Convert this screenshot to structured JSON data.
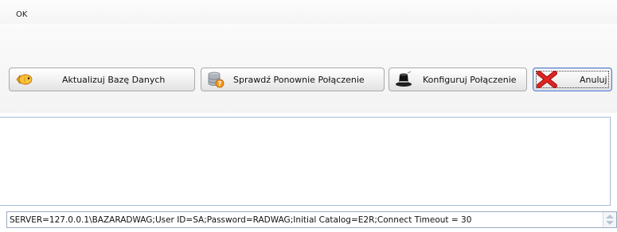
{
  "status": {
    "text": "OK"
  },
  "toolbar": {
    "update_db_label": "Aktualizuj Bazę Danych",
    "check_connection_label": "Sprawdź Ponownie Połączenie",
    "configure_connection_label": "Konfiguruj Połączenie",
    "cancel_label": "Anuluj"
  },
  "log": {
    "text": ""
  },
  "connection": {
    "value": "SERVER=127.0.0.1\\BAZARADWAG;User ID=SA;Password=RADWAG;Initial Catalog=E2R;Connect Timeout = 30"
  },
  "icons": {
    "update_db": "fish-icon",
    "check_connection": "database-check-icon",
    "configure_connection": "magic-hat-icon",
    "cancel": "red-x-icon"
  },
  "colors": {
    "accent_focus_border": "#5a7ec7",
    "cancel_x": "#d21a1a",
    "field_border": "#a7bad8"
  }
}
